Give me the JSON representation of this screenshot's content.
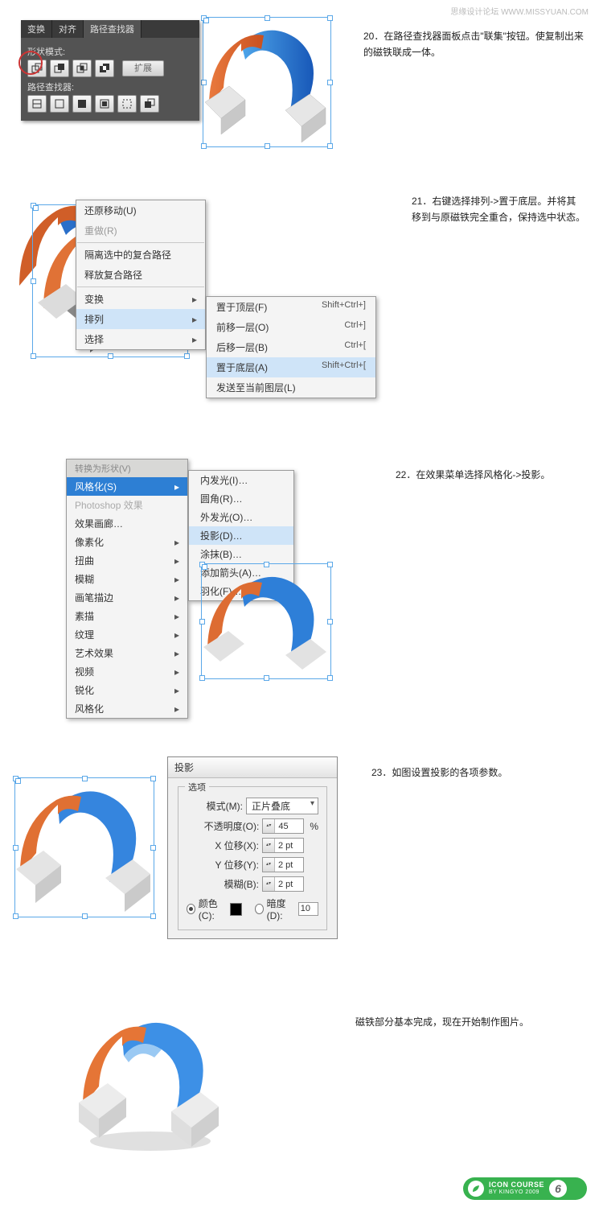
{
  "watermark": "思缘设计论坛  WWW.MISSYUAN.COM",
  "step20": {
    "text": "20．在路径查找器面板点击\"联集\"按钮。使复制出来的磁铁联成一体。",
    "panel": {
      "tabs": [
        "变换",
        "对齐",
        "路径查找器"
      ],
      "shape_mode": "形状模式:",
      "expand": "扩展",
      "pathfinder": "路径查找器:"
    }
  },
  "step21": {
    "text": "21．右键选择排列->置于底层。并将其移到与原磁铁完全重合，保持选中状态。",
    "menu": {
      "undo": "还原移动(U)",
      "redo": "重做(R)",
      "isolate": "隔离选中的复合路径",
      "release": "释放复合路径",
      "transform": "变换",
      "arrange": "排列",
      "select": "选择"
    },
    "submenu": {
      "front": "置于顶层(F)",
      "fwd": "前移一层(O)",
      "back": "后移一层(B)",
      "bottom": "置于底层(A)",
      "send": "发送至当前图层(L)",
      "s_front": "Shift+Ctrl+]",
      "s_fwd": "Ctrl+]",
      "s_back": "Ctrl+[",
      "s_bottom": "Shift+Ctrl+["
    }
  },
  "step22": {
    "text": "22．在效果菜单选择风格化->投影。",
    "effect": {
      "convert": "转换为形状(V)",
      "stylize": "风格化(S)",
      "ps": "Photoshop 效果",
      "gallery": "效果画廊…",
      "pixelate": "像素化",
      "distort": "扭曲",
      "blur": "模糊",
      "brush": "画笔描边",
      "sketch": "素描",
      "texture": "纹理",
      "artistic": "艺术效果",
      "video": "视频",
      "sharpen": "锐化",
      "stylize2": "风格化"
    },
    "sub": {
      "inner": "内发光(I)…",
      "round": "圆角(R)…",
      "outer": "外发光(O)…",
      "shadow": "投影(D)…",
      "scribble": "涂抹(B)…",
      "arrow": "添加箭头(A)…",
      "feather": "羽化(F)…"
    }
  },
  "step23": {
    "text": "23．如图设置投影的各项参数。",
    "dlg": {
      "title": "投影",
      "options": "选项",
      "mode": "模式(M):",
      "mode_v": "正片叠底",
      "opacity": "不透明度(O):",
      "opacity_v": "45",
      "x": "X 位移(X):",
      "x_v": "2 pt",
      "y": "Y 位移(Y):",
      "y_v": "2 pt",
      "blur": "模糊(B):",
      "blur_v": "2 pt",
      "color": "颜色(C):",
      "dark": "暗度(D):",
      "dark_v": "10",
      "pct": "%"
    }
  },
  "final": "磁铁部分基本完成，现在开始制作图片。",
  "badge": {
    "title": "ICON COURSE",
    "sub": "BY KINGYO 2009",
    "num": "6"
  }
}
